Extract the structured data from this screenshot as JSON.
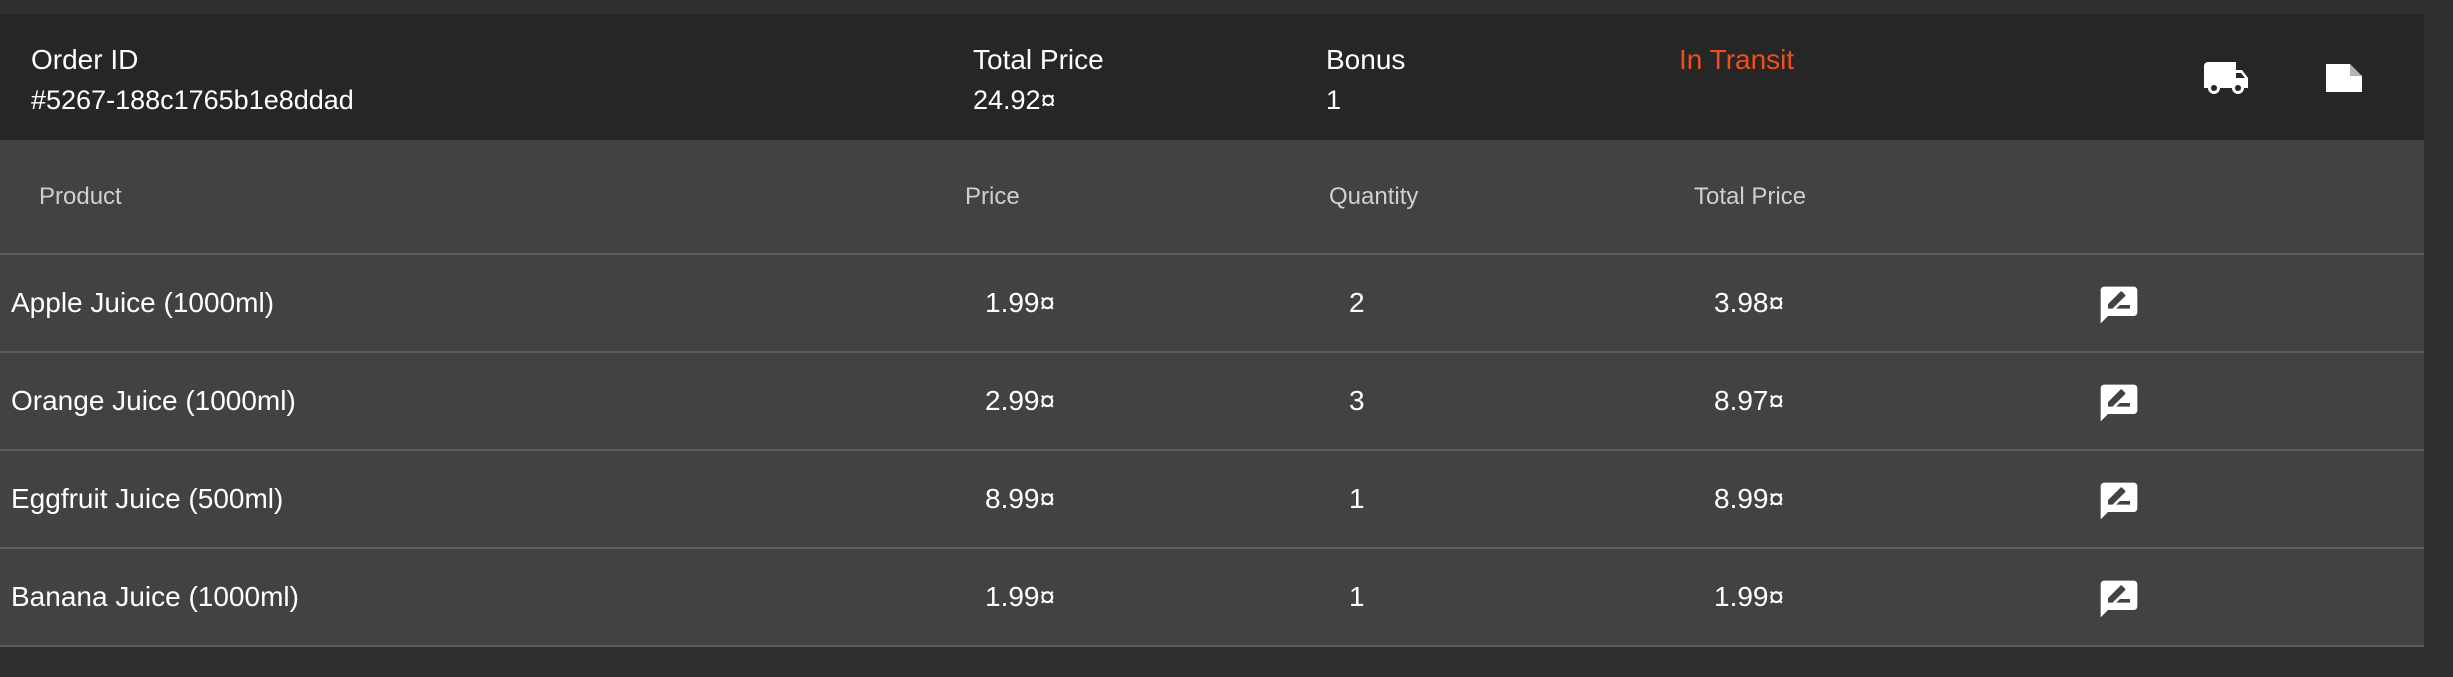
{
  "order": {
    "id_label": "Order ID",
    "id_value": "#5267-188c1765b1e8ddad",
    "total_label": "Total Price",
    "total_value": "24.92¤",
    "bonus_label": "Bonus",
    "bonus_value": "1",
    "status": "In Transit",
    "status_color": "#ef4f1a",
    "actions": [
      {
        "icon": "truck-icon"
      },
      {
        "icon": "receipt-icon"
      }
    ]
  },
  "table": {
    "columns": [
      "Product",
      "Price",
      "Quantity",
      "Total Price"
    ],
    "rows": [
      {
        "product": "Apple Juice (1000ml)",
        "price": "1.99¤",
        "quantity": "2",
        "total": "3.98¤",
        "action_icon": "rate-review-icon"
      },
      {
        "product": "Orange Juice (1000ml)",
        "price": "2.99¤",
        "quantity": "3",
        "total": "8.97¤",
        "action_icon": "rate-review-icon"
      },
      {
        "product": "Eggfruit Juice (500ml)",
        "price": "8.99¤",
        "quantity": "1",
        "total": "8.99¤",
        "action_icon": "rate-review-icon"
      },
      {
        "product": "Banana Juice (1000ml)",
        "price": "1.99¤",
        "quantity": "1",
        "total": "1.99¤",
        "action_icon": "rate-review-icon"
      }
    ]
  }
}
